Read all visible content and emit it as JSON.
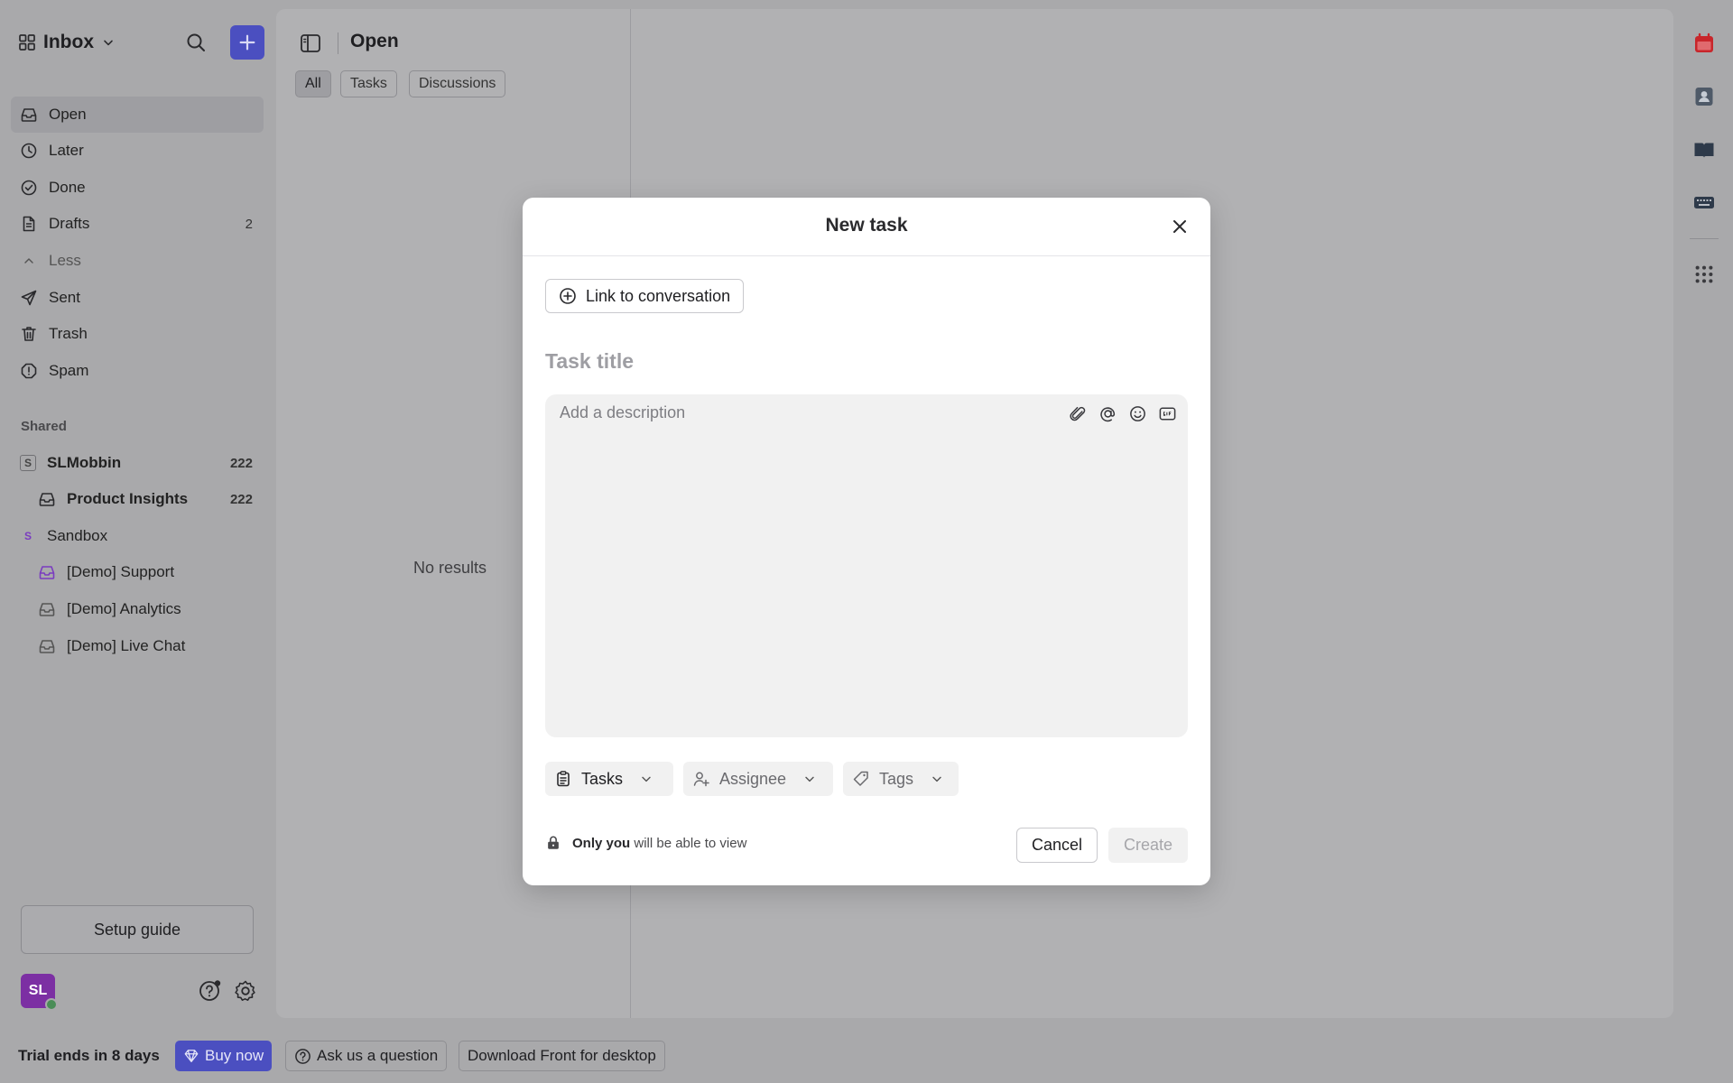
{
  "sidebar": {
    "workspace": "Inbox",
    "nav": [
      {
        "label": "Open"
      },
      {
        "label": "Later"
      },
      {
        "label": "Done"
      },
      {
        "label": "Drafts",
        "count": "2"
      },
      {
        "label": "Less"
      },
      {
        "label": "Sent"
      },
      {
        "label": "Trash"
      },
      {
        "label": "Spam"
      }
    ],
    "shared_label": "Shared",
    "shared": [
      {
        "badge": "S",
        "label": "SLMobbin",
        "count": "222"
      },
      {
        "label": "Product Insights",
        "count": "222"
      },
      {
        "badge": "S",
        "label": "Sandbox"
      },
      {
        "label": "[Demo] Support"
      },
      {
        "label": "[Demo] Analytics"
      },
      {
        "label": "[Demo] Live Chat"
      }
    ],
    "setup_guide": "Setup guide",
    "avatar_initials": "SL"
  },
  "main": {
    "title": "Open",
    "tabs": [
      "All",
      "Tasks",
      "Discussions"
    ],
    "empty_text": "No results"
  },
  "bottom_bar": {
    "trial": "Trial ends in 8 days",
    "buy_now": "Buy now",
    "ask": "Ask us a question",
    "download": "Download Front for desktop"
  },
  "modal": {
    "title": "New task",
    "link_label": "Link to conversation",
    "title_placeholder": "Task title",
    "description_placeholder": "Add a description",
    "task_type": "Tasks",
    "assignee": "Assignee",
    "tags": "Tags",
    "privacy_bold": "Only you",
    "privacy_rest": " will be able to view",
    "cancel": "Cancel",
    "create": "Create"
  },
  "colors": {
    "accent": "#4b4fc0",
    "calendar_red": "#c8262b",
    "avatar": "#7c2fa3",
    "overlay_bg": "#a9a9ab"
  },
  "icons": [
    "grid-icon",
    "chevron-down-icon",
    "search-icon",
    "plus-icon",
    "inbox-icon",
    "clock-icon",
    "check-circle-icon",
    "draft-icon",
    "chevron-up-icon",
    "send-icon",
    "trash-icon",
    "spam-icon",
    "sidebar-toggle-icon",
    "close-icon",
    "plus-circle-icon",
    "paperclip-icon",
    "at-icon",
    "emoji-icon",
    "gif-icon",
    "clipboard-icon",
    "user-plus-icon",
    "tag-icon",
    "lock-icon",
    "help-icon",
    "gear-icon",
    "calendar-icon",
    "contacts-icon",
    "book-icon",
    "keyboard-icon",
    "apps-icon",
    "diamond-icon",
    "question-circle-icon"
  ]
}
